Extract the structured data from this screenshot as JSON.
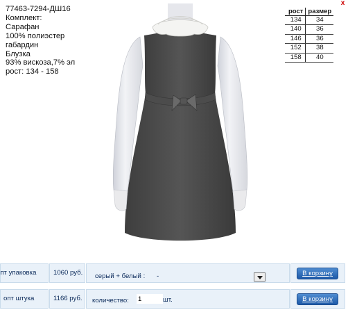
{
  "product": {
    "lines": [
      "77463-7294-ДШ16",
      "Комплект:",
      "Сарафан",
      "100% полиэстер",
      "габардин",
      "Блузка",
      "93% вискоза,7% эл",
      "рост: 134 - 158"
    ]
  },
  "size_table": {
    "headers": [
      "рост",
      "размер"
    ],
    "rows": [
      [
        "134",
        "34"
      ],
      [
        "140",
        "36"
      ],
      [
        "146",
        "36"
      ],
      [
        "152",
        "38"
      ],
      [
        "158",
        "40"
      ]
    ]
  },
  "close_label": "x",
  "order_rows": [
    {
      "label": "опт упаковка",
      "price": "1060 руб.",
      "detail": "серый + белый :",
      "detail_value": "-",
      "button": "В корзину"
    },
    {
      "label": "опт штука",
      "price": "1166 руб.",
      "detail": "количество:",
      "detail_value": "1",
      "unit": "шт.",
      "button": "В корзину"
    }
  ],
  "colors": {
    "dress": "#4a4a4a",
    "sleeve": "#ebebef",
    "order_bg": "#e9f1f9",
    "order_text": "#0b2a5a",
    "button": "#2a68b4"
  }
}
